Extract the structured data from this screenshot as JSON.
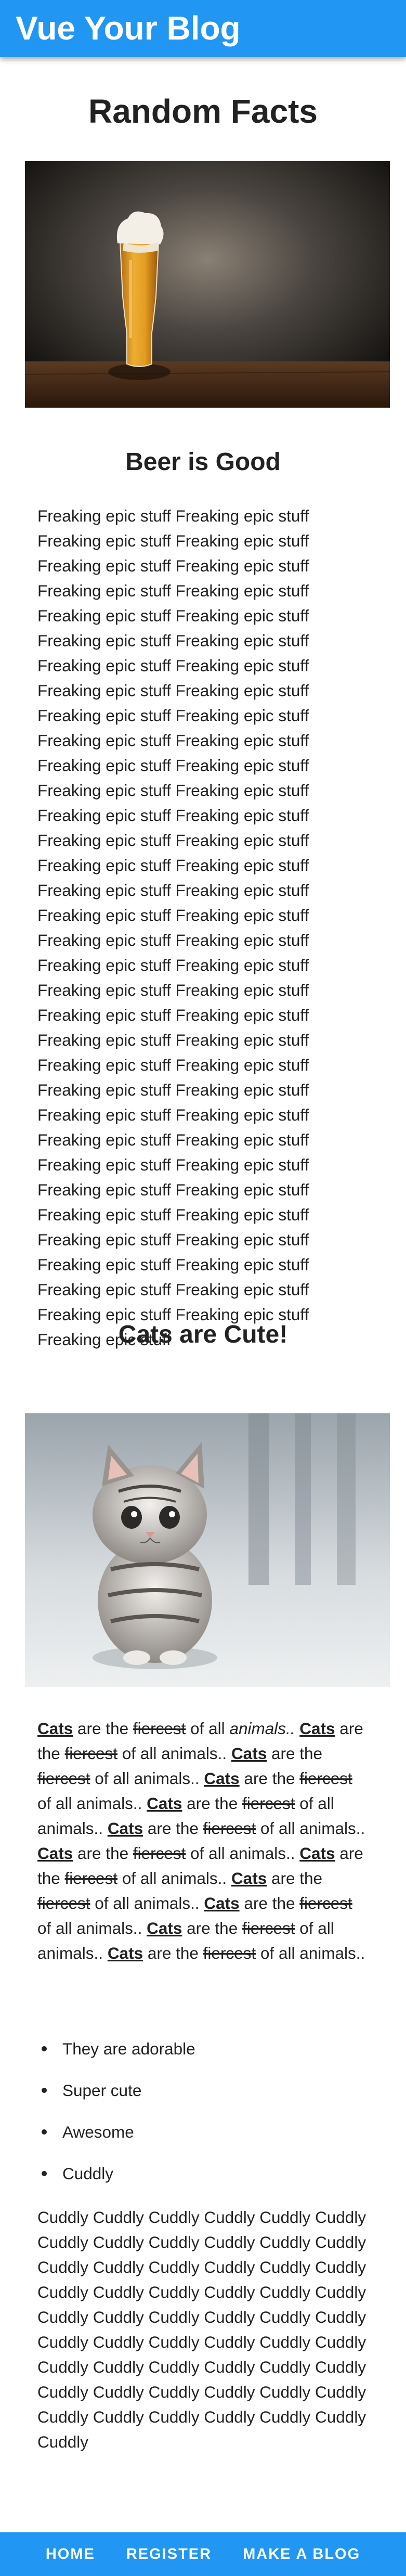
{
  "app": {
    "title": "Vue Your Blog"
  },
  "page": {
    "title": "Random Facts"
  },
  "beer": {
    "title": "Beer is Good",
    "text": "Freaking epic stuff Freaking epic stuff Freaking epic stuff Freaking epic stuff Freaking epic stuff Freaking epic stuff Freaking epic stuff Freaking epic stuff Freaking epic stuff Freaking epic stuff Freaking epic stuff Freaking epic stuff Freaking epic stuff Freaking epic stuff Freaking epic stuff Freaking epic stuff Freaking epic stuff Freaking epic stuff Freaking epic stuff Freaking epic stuff Freaking epic stuff Freaking epic stuff Freaking epic stuff Freaking epic stuff Freaking epic stuff Freaking epic stuff Freaking epic stuff Freaking epic stuff Freaking epic stuff Freaking epic stuff Freaking epic stuff Freaking epic stuff Freaking epic stuff Freaking epic stuff Freaking epic stuff Freaking epic stuff Freaking epic stuff Freaking epic stuff Freaking epic stuff Freaking epic stuff Freaking epic stuff Freaking epic stuff Freaking epic stuff Freaking epic stuff Freaking epic stuff Freaking epic stuff Freaking epic stuff Freaking epic stuff Freaking epic stuff Freaking epic stuff Freaking epic stuff Freaking epic stuff Freaking epic stuff Freaking epic stuff Freaking epic stuff Freaking epic stuff Freaking epic stuff Freaking epic stuff Freaking epic stuff Freaking epic stuff Freaking epic stuff Freaking epic stuff Freaking epic stuff Freaking epic stuff Freaking epic stuff Freaking epic stuff Freaking epic stuff"
  },
  "cats": {
    "title": "Cats are Cute!",
    "phrase": {
      "subject": "Cats",
      "verb": "are the",
      "struck": "fiercest",
      "rest": "of all",
      "animals": "animals",
      "end": ".."
    },
    "repeat_count": 12,
    "bullets": [
      "They are adorable",
      "Super cute",
      "Awesome",
      "Cuddly"
    ],
    "cuddly_text": "Cuddly Cuddly Cuddly Cuddly Cuddly Cuddly Cuddly Cuddly Cuddly Cuddly Cuddly Cuddly Cuddly Cuddly Cuddly Cuddly Cuddly Cuddly Cuddly Cuddly Cuddly Cuddly Cuddly Cuddly Cuddly Cuddly Cuddly Cuddly Cuddly Cuddly Cuddly Cuddly Cuddly Cuddly Cuddly Cuddly Cuddly Cuddly Cuddly Cuddly Cuddly Cuddly Cuddly Cuddly Cuddly Cuddly Cuddly Cuddly Cuddly Cuddly Cuddly Cuddly Cuddly Cuddly Cuddly"
  },
  "footer": {
    "links": [
      "HOME",
      "REGISTER",
      "MAKE A BLOG"
    ]
  },
  "colors": {
    "primary": "#2196F3",
    "text": "#222222",
    "background": "#FFFFFF"
  }
}
